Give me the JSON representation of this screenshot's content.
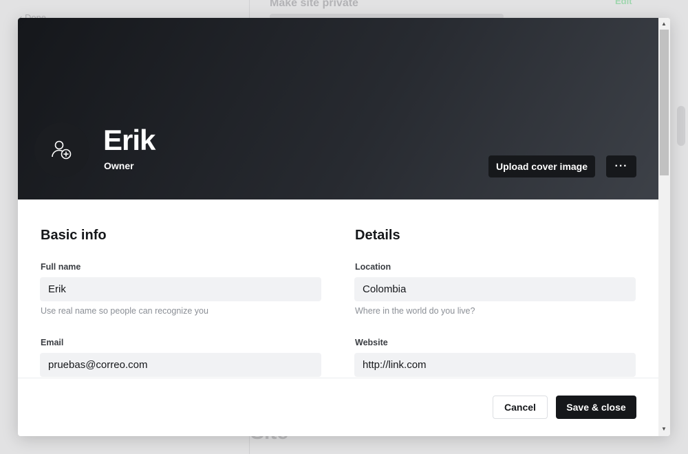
{
  "background": {
    "sidebar_item": "Done",
    "heading": "Make site private",
    "action": "Edit",
    "big_text": "Site"
  },
  "profile": {
    "name": "Erik",
    "role": "Owner",
    "avatar_icon": "user-plus-icon",
    "upload_cover_label": "Upload cover image",
    "more_label": "···"
  },
  "basic_info": {
    "title": "Basic info",
    "full_name": {
      "label": "Full name",
      "value": "Erik",
      "hint": "Use real name so people can recognize you"
    },
    "email": {
      "label": "Email",
      "value": "pruebas@correo.com"
    }
  },
  "details": {
    "title": "Details",
    "location": {
      "label": "Location",
      "value": "Colombia",
      "hint": "Where in the world do you live?"
    },
    "website": {
      "label": "Website",
      "value": "http://link.com"
    }
  },
  "footer": {
    "cancel_label": "Cancel",
    "save_label": "Save & close"
  },
  "colors": {
    "cover_dark": "#15171b",
    "primary_button": "#15171a",
    "input_bg": "#f1f2f4"
  }
}
